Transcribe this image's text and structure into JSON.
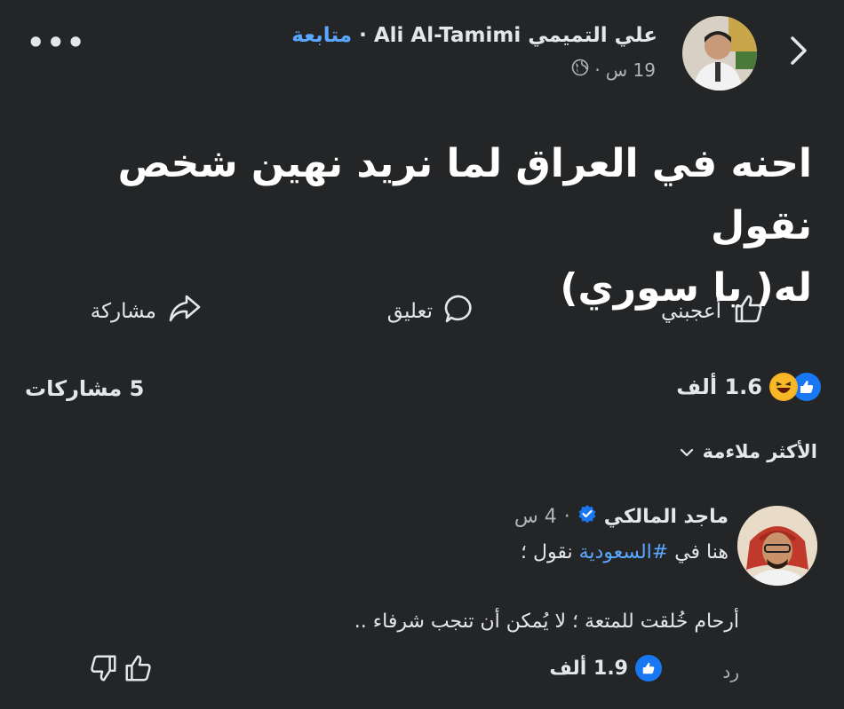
{
  "post": {
    "author_ar": "علي التميمي",
    "author_en": "Ali Al-Tamimi",
    "follow_label": "متابعة",
    "time": "19 س",
    "text_line1": "احنه في العراق لما نريد نهين شخص نقول",
    "text_line2": "له( يا سوري)"
  },
  "actions": {
    "like": "أعجبني",
    "comment": "تعليق",
    "share": "مشاركة"
  },
  "stats": {
    "reactions_count": "1.6 ألف",
    "shares": "5 مشاركات"
  },
  "sort": {
    "label": "الأكثر ملاءمة"
  },
  "comment": {
    "author": "ماجد المالكي",
    "time": "4 س",
    "line1_before": "هنا في ",
    "hashtag": "#السعودية",
    "line1_after": " نقول ؛",
    "line2": "أرحام خُلقت للمتعة ؛ لا يُمكن أن تنجب شرفاء ..",
    "reply_label": "رد",
    "likes": "1.9 ألف"
  },
  "colors": {
    "background": "#242526",
    "link": "#5aa7ff",
    "like_blue": "#1877f2"
  }
}
